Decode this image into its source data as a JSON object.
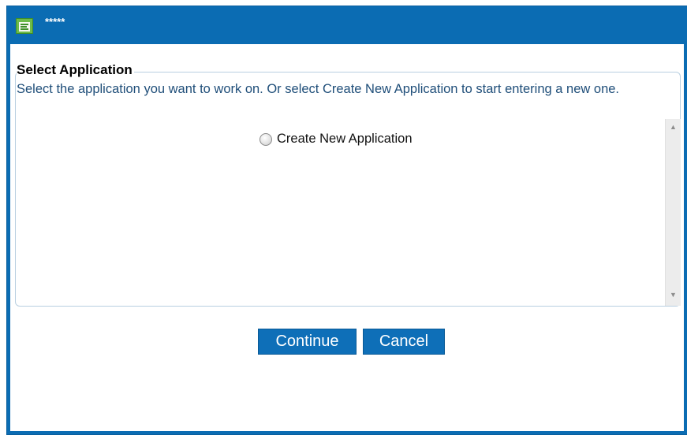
{
  "window": {
    "title": "*****",
    "icon": "form-document-icon",
    "colors": {
      "frame": "#0b6cb3",
      "button": "#0e6fb8",
      "instruction_text": "#1f4e79"
    }
  },
  "select_application": {
    "legend": "Select Application",
    "instructions": "Select the application you want to work on. Or select Create New Application to start entering a new one.",
    "options": [
      {
        "label": "Create New Application",
        "selected": false
      }
    ],
    "scroll_up_icon": "scroll-up-arrow-icon",
    "scroll_down_icon": "scroll-down-arrow-icon"
  },
  "buttons": {
    "continue_label": "Continue",
    "cancel_label": "Cancel"
  }
}
